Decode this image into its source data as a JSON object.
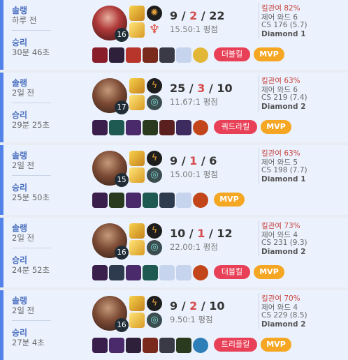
{
  "matches": [
    {
      "queue": "솔랭",
      "ago": "하루 전",
      "result": "승리",
      "duration": "30분 46초",
      "champion_icon": "red-champion-portrait",
      "level": "16",
      "spell_icons": [
        "smite-icon",
        "flash-icon"
      ],
      "rune_icons": [
        "conqueror-icon",
        "domination-icon"
      ],
      "kills": "9",
      "deaths": "2",
      "assists": "22",
      "kda_ratio": "15.50:1 평점",
      "kill_participation": "킬관여 82%",
      "control_wards": "제어 와드 6",
      "cs": "CS 176 (5.7)",
      "avg_tier": "Diamond 1",
      "items": [
        {
          "icon": "item-icon",
          "color": "#8a1d2a"
        },
        {
          "icon": "item-icon",
          "color": "#2e1f3a"
        },
        {
          "icon": "item-icon",
          "color": "#b8352c"
        },
        {
          "icon": "item-icon",
          "color": "#7a2a1c"
        },
        {
          "icon": "item-icon",
          "color": "#3a3a46"
        },
        {
          "icon": "empty-slot-icon",
          "color": ""
        },
        {
          "icon": "ward-trinket-icon",
          "color": "#e2b737"
        }
      ],
      "multikill": "더블킬",
      "mvp": "MVP"
    },
    {
      "queue": "솔랭",
      "ago": "2일 전",
      "result": "승리",
      "duration": "29분 25초",
      "champion_icon": "champion-portrait",
      "level": "17",
      "spell_icons": [
        "smite-icon",
        "flash-icon"
      ],
      "rune_icons": [
        "electrocute-icon",
        "precision-icon"
      ],
      "kills": "25",
      "deaths": "3",
      "assists": "10",
      "kda_ratio": "11.67:1 평점",
      "kill_participation": "킬관여 63%",
      "control_wards": "제어 와드 6",
      "cs": "CS 219 (7.4)",
      "avg_tier": "Diamond 2",
      "items": [
        {
          "icon": "item-icon",
          "color": "#3a1f4d"
        },
        {
          "icon": "item-icon",
          "color": "#1e5a52"
        },
        {
          "icon": "item-icon",
          "color": "#4a2a6a"
        },
        {
          "icon": "item-icon",
          "color": "#2a3a1e"
        },
        {
          "icon": "item-icon",
          "color": "#5a1f1f"
        },
        {
          "icon": "item-icon",
          "color": "#3d2a5e"
        },
        {
          "icon": "ward-trinket-icon",
          "color": "#c2461a"
        }
      ],
      "multikill": "쿼드라킬",
      "mvp": "MVP"
    },
    {
      "queue": "솔랭",
      "ago": "2일 전",
      "result": "승리",
      "duration": "25분 50초",
      "champion_icon": "champion-portrait",
      "level": "15",
      "spell_icons": [
        "smite-icon",
        "flash-icon"
      ],
      "rune_icons": [
        "electrocute-icon",
        "precision-icon"
      ],
      "kills": "9",
      "deaths": "1",
      "assists": "6",
      "kda_ratio": "15.00:1 평점",
      "kill_participation": "킬관여 63%",
      "control_wards": "제어 와드 5",
      "cs": "CS 198 (7.7)",
      "avg_tier": "Diamond 1",
      "items": [
        {
          "icon": "item-icon",
          "color": "#3a1f4d"
        },
        {
          "icon": "item-icon",
          "color": "#2a3a1e"
        },
        {
          "icon": "item-icon",
          "color": "#4a2a6a"
        },
        {
          "icon": "item-icon",
          "color": "#1e5a52"
        },
        {
          "icon": "item-icon",
          "color": "#2e3a4d"
        },
        {
          "icon": "empty-slot-icon",
          "color": ""
        },
        {
          "icon": "ward-trinket-icon",
          "color": "#c2461a"
        }
      ],
      "multikill": "",
      "mvp": "MVP"
    },
    {
      "queue": "솔랭",
      "ago": "2일 전",
      "result": "승리",
      "duration": "24분 52초",
      "champion_icon": "champion-portrait",
      "level": "16",
      "spell_icons": [
        "smite-icon",
        "flash-icon"
      ],
      "rune_icons": [
        "electrocute-icon",
        "precision-icon"
      ],
      "kills": "10",
      "deaths": "1",
      "assists": "12",
      "kda_ratio": "22.00:1 평점",
      "kill_participation": "킬관여 73%",
      "control_wards": "제어 와드 4",
      "cs": "CS 231 (9.3)",
      "avg_tier": "Diamond 2",
      "items": [
        {
          "icon": "item-icon",
          "color": "#3a1f4d"
        },
        {
          "icon": "item-icon",
          "color": "#2e3a4d"
        },
        {
          "icon": "item-icon",
          "color": "#4a2a6a"
        },
        {
          "icon": "item-icon",
          "color": "#1e5a52"
        },
        {
          "icon": "empty-slot-icon",
          "color": ""
        },
        {
          "icon": "empty-slot-icon",
          "color": ""
        },
        {
          "icon": "ward-trinket-icon",
          "color": "#c2461a"
        }
      ],
      "multikill": "더블킬",
      "mvp": "MVP"
    },
    {
      "queue": "솔랭",
      "ago": "2일 전",
      "result": "승리",
      "duration": "27분 4초",
      "champion_icon": "champion-portrait",
      "level": "16",
      "spell_icons": [
        "smite-icon",
        "flash-icon"
      ],
      "rune_icons": [
        "electrocute-icon",
        "precision-icon"
      ],
      "kills": "9",
      "deaths": "2",
      "assists": "10",
      "kda_ratio": "9.50:1 평점",
      "kill_participation": "킬관여 70%",
      "control_wards": "제어 와드 4",
      "cs": "CS 229 (8.5)",
      "avg_tier": "Diamond 2",
      "items": [
        {
          "icon": "item-icon",
          "color": "#3a1f4d"
        },
        {
          "icon": "item-icon",
          "color": "#4a2a6a"
        },
        {
          "icon": "item-icon",
          "color": "#2e1f3a"
        },
        {
          "icon": "item-icon",
          "color": "#7a2a1c"
        },
        {
          "icon": "item-icon",
          "color": "#3a3a46"
        },
        {
          "icon": "item-icon",
          "color": "#2a3a1e"
        },
        {
          "icon": "ward-trinket-icon",
          "color": "#2e7fb8"
        }
      ],
      "multikill": "트리플킬",
      "mvp": "MVP"
    }
  ]
}
